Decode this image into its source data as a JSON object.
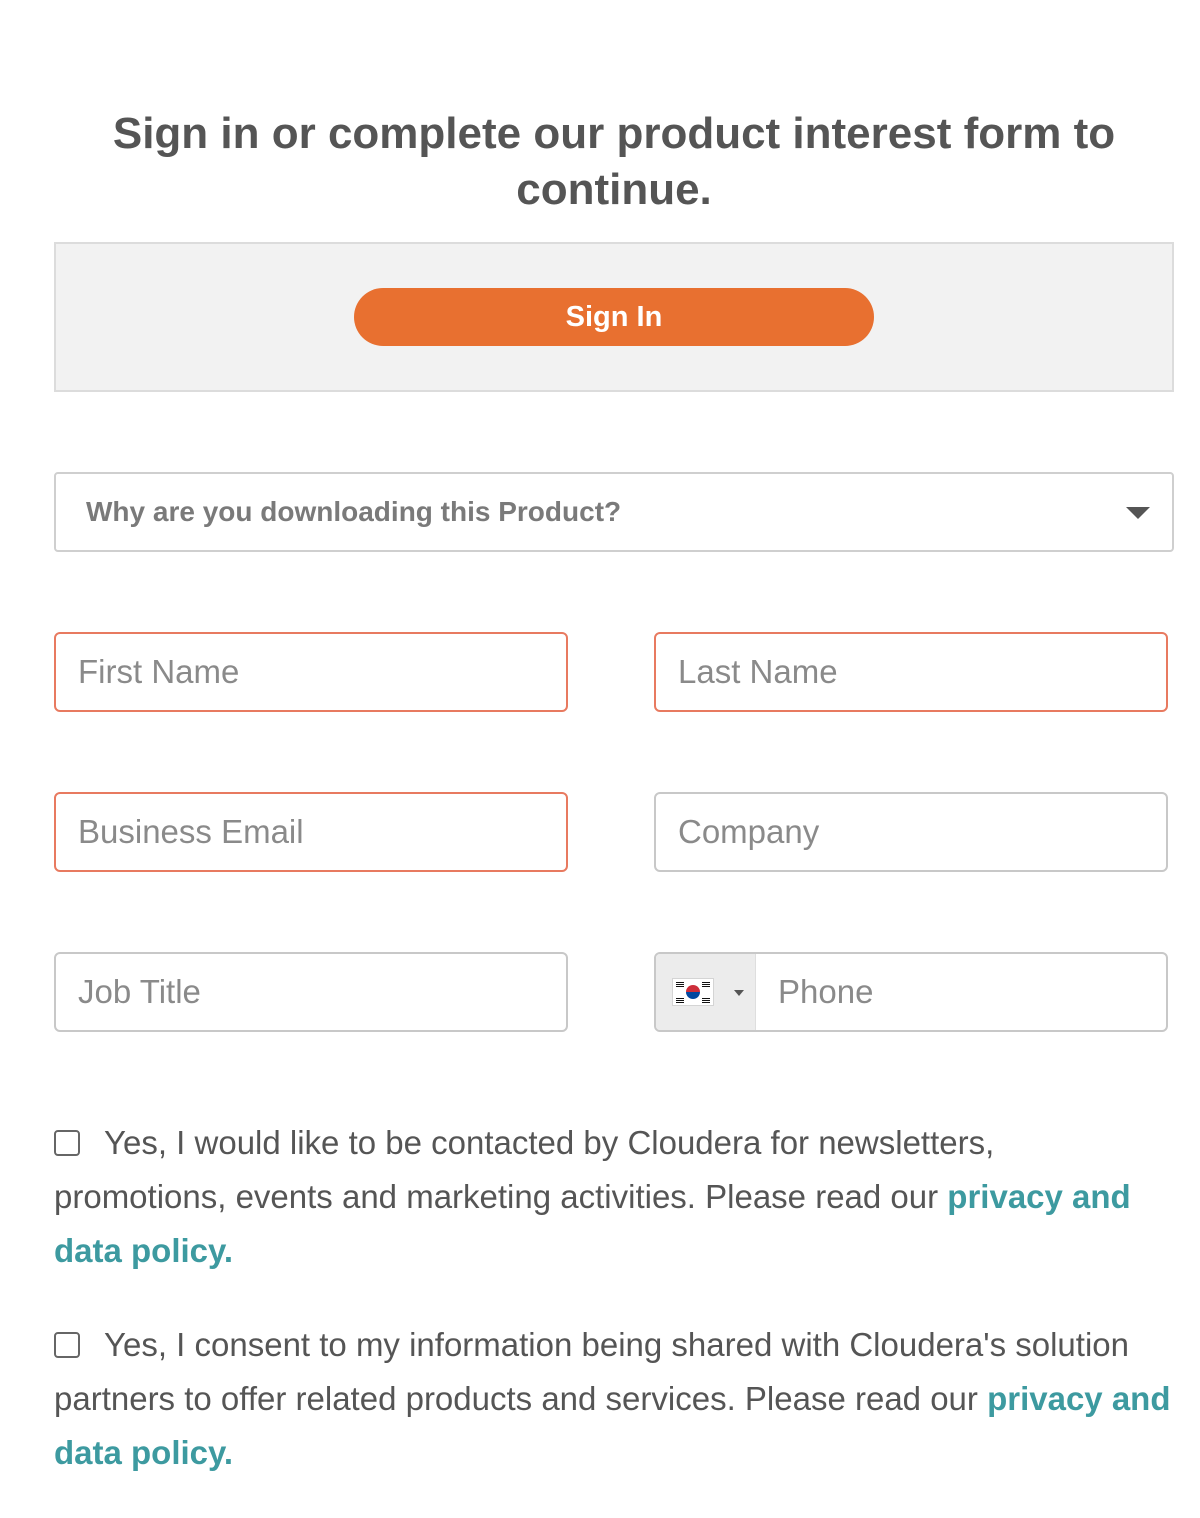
{
  "headline": "Sign in or complete our product interest form to continue.",
  "signin": {
    "button_label": "Sign In"
  },
  "reason_select": {
    "selected": "Why are you downloading this Product?"
  },
  "fields": {
    "first_name": {
      "placeholder": "First Name",
      "value": ""
    },
    "last_name": {
      "placeholder": "Last Name",
      "value": ""
    },
    "business_email": {
      "placeholder": "Business Email",
      "value": ""
    },
    "company": {
      "placeholder": "Company",
      "value": ""
    },
    "job_title": {
      "placeholder": "Job Title",
      "value": ""
    },
    "phone": {
      "placeholder": "Phone",
      "value": "",
      "country_flag": "south-korea-flag-icon"
    }
  },
  "consents": [
    {
      "text": "Yes, I would like to be contacted by Cloudera for newsletters, promotions, events and marketing activities. Please read our ",
      "link": "privacy and data policy.",
      "checked": false
    },
    {
      "text": "Yes, I consent to my information being shared with Cloudera's solution partners to offer related products and services. Please read our ",
      "link": "privacy and data policy.",
      "checked": false
    }
  ],
  "colors": {
    "accent": "#e87030",
    "link": "#3d9aa0",
    "error_border": "#e87a60",
    "text": "#555555"
  }
}
